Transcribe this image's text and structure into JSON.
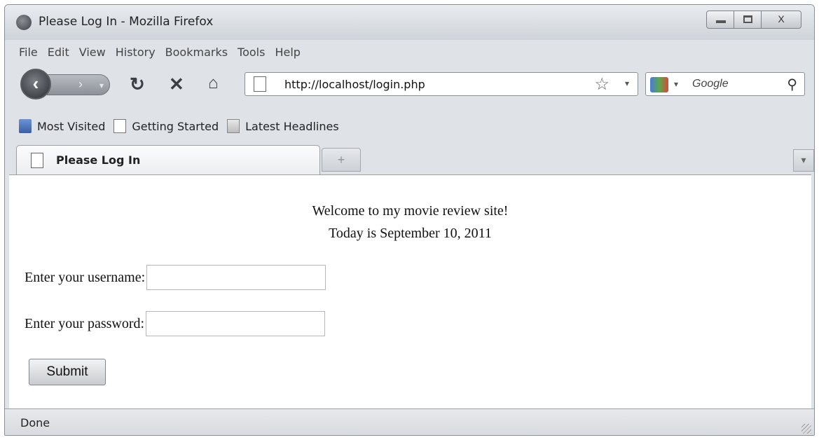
{
  "window": {
    "title": "Please Log In - Mozilla Firefox",
    "controls": {
      "minimize": "",
      "maximize": "",
      "close": "X"
    }
  },
  "menubar": {
    "items": [
      "File",
      "Edit",
      "View",
      "History",
      "Bookmarks",
      "Tools",
      "Help"
    ]
  },
  "navbar": {
    "url": "http://localhost/login.php",
    "search_placeholder": "Google",
    "icons": [
      "back-icon",
      "forward-icon",
      "reload-icon",
      "stop-icon",
      "home-icon",
      "page-icon",
      "bookmark-star-icon",
      "google-icon",
      "magnifier-icon"
    ]
  },
  "bookmarks": {
    "items": [
      {
        "label": "Most Visited",
        "icon": "most-visited-icon"
      },
      {
        "label": "Getting Started",
        "icon": "page-icon"
      },
      {
        "label": "Latest Headlines",
        "icon": "rss-icon"
      }
    ]
  },
  "tabs": {
    "active_label": "Please Log In",
    "new_tab_symbol": "+"
  },
  "page": {
    "welcome": "Welcome to my movie review site!",
    "date_line": "Today is September 10, 2011",
    "username_label": "Enter your username:",
    "username_value": "",
    "password_label": "Enter your password:",
    "password_value": "",
    "submit_label": "Submit"
  },
  "status": {
    "text": "Done"
  }
}
